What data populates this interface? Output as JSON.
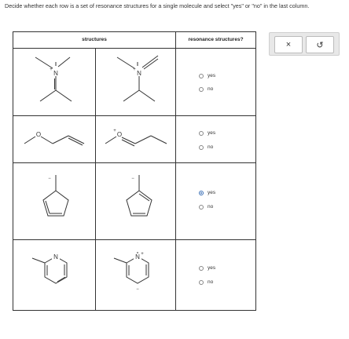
{
  "instructions": "Decide whether each row is a set of resonance structures for a single molecule and select \"yes\" or \"no\" in the last column.",
  "table": {
    "header_structures": "structures",
    "header_resonance": "resonance structures?"
  },
  "rows": [
    {
      "yes_label": "yes",
      "no_label": "no",
      "selected": null
    },
    {
      "yes_label": "yes",
      "no_label": "no",
      "selected": null
    },
    {
      "yes_label": "yes",
      "no_label": "no",
      "selected": "yes"
    },
    {
      "yes_label": "yes",
      "no_label": "no",
      "selected": null
    }
  ],
  "atoms": {
    "n": "N",
    "o": "O",
    "plus": "+",
    "minus": "−"
  },
  "buttons": {
    "clear": "×",
    "undo": "↺"
  },
  "colors": {
    "selected": "#3a6fb5",
    "border": "#333333"
  },
  "icons": {
    "clear": "close-icon",
    "undo": "undo-icon"
  }
}
